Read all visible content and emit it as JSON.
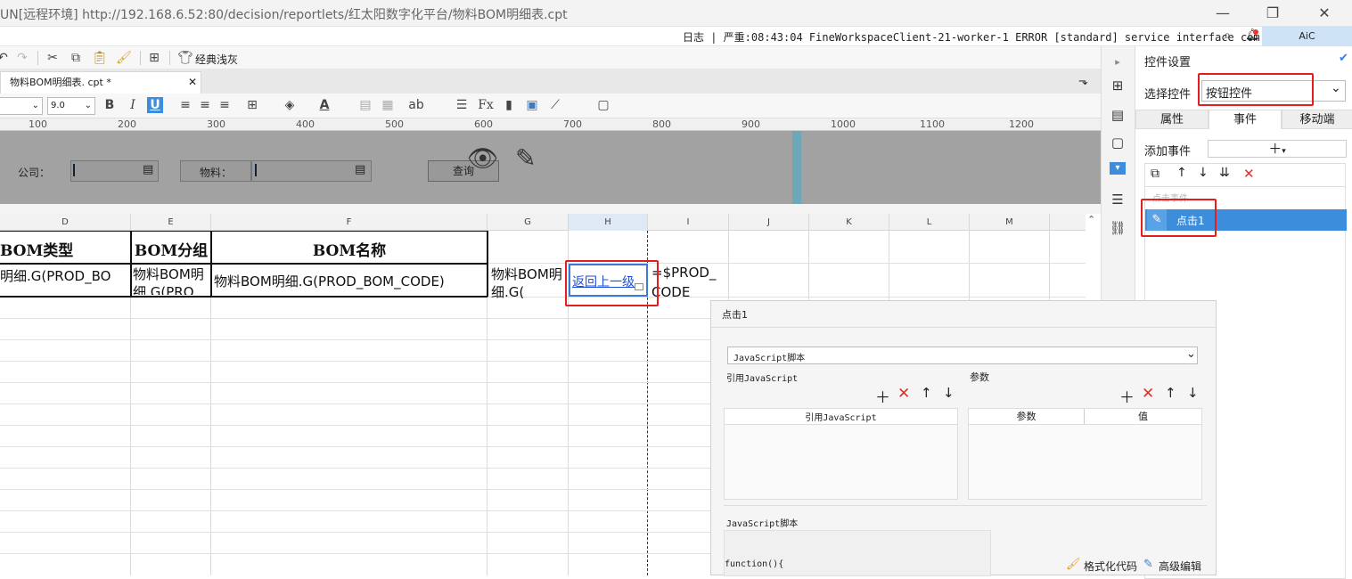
{
  "titlebar": {
    "title": "UN[远程环境]    http://192.168.6.52:80/decision/reportlets/红太阳数字化平台/物料BOM明细表.cpt",
    "minimize": "—",
    "restore": "❐",
    "close": "✕"
  },
  "statusbar": {
    "log_text": "日志 | 严重:08:43:04 FineWorkspaceClient-21-worker-1 ERROR [standard] service interface com.fr.wo...",
    "user": "AiC"
  },
  "toolbar": {
    "classic_theme_label": "经典浅灰"
  },
  "tab": {
    "label": "物料BOM明细表. cpt *"
  },
  "format_toolbar": {
    "font_size": "9.0"
  },
  "ruler": {
    "ticks": [
      "100",
      "200",
      "300",
      "400",
      "500",
      "600",
      "700",
      "800",
      "900",
      "1000",
      "1100",
      "1200"
    ]
  },
  "form": {
    "company_label": "公司：",
    "material_label": "物料：",
    "query_button": "查询"
  },
  "columns": [
    "D",
    "E",
    "F",
    "G",
    "H",
    "I",
    "J",
    "K",
    "L",
    "M"
  ],
  "grid": {
    "header_row": {
      "d": "BOM类型",
      "e": "BOM分组",
      "f": "BOM名称"
    },
    "data_row": {
      "d": "明细.G(PROD_BO",
      "e_line1": "物料BOM明",
      "e_line2": "细.G(PRO",
      "f": "物料BOM明细.G(PROD_BOM_CODE)",
      "g_line1": "物料BOM明",
      "g_line2": "细.G(",
      "h": "返回上一级",
      "i_line1": "=$PROD_",
      "i_line2": "CODE"
    }
  },
  "panel": {
    "title": "控件设置",
    "select_widget_label": "选择控件",
    "select_widget_value": "按钮控件",
    "tabs": [
      "属性",
      "事件",
      "移动端"
    ],
    "add_event_label": "添加事件",
    "event_group_label": "点击事件",
    "event_item": "点击1"
  },
  "popup": {
    "title": "点击1",
    "type_select": "JavaScript脚本",
    "ref_js_label": "引用JavaScript",
    "params_label": "参数",
    "ref_js_col": "引用JavaScript",
    "param_col": "参数",
    "value_col": "值",
    "script_label": "JavaScript脚本",
    "format_code": "格式化代码",
    "advanced_edit": "高级编辑",
    "code_line": "function(){"
  }
}
